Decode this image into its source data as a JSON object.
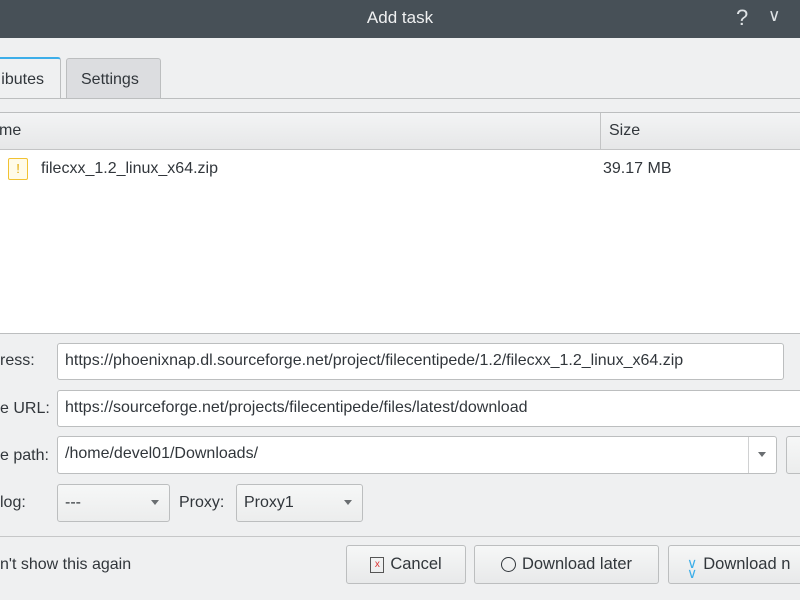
{
  "window": {
    "title": "Add task"
  },
  "tabs": [
    {
      "label": "ibutes",
      "active": true
    },
    {
      "label": "Settings",
      "active": false
    }
  ],
  "file_list": {
    "columns": [
      "me",
      "Size"
    ],
    "rows": [
      {
        "icon": "zip-file-icon",
        "name": "filecxx_1.2_linux_x64.zip",
        "size": "39.17 MB"
      }
    ]
  },
  "form": {
    "address_label": "ress:",
    "address_value": "https://phoenixnap.dl.sourceforge.net/project/filecentipede/1.2/filecxx_1.2_linux_x64.zip",
    "source_label": "e URL:",
    "source_value": "https://sourceforge.net/projects/filecentipede/files/latest/download",
    "path_label": "e path:",
    "path_value": "/home/devel01/Downloads/",
    "log_label": "log:",
    "log_value": "---",
    "proxy_label": "Proxy:",
    "proxy_value": "Proxy1"
  },
  "footer": {
    "dont_show": "n't show this again",
    "cancel": "Cancel",
    "later": "Download later",
    "now": "Download n"
  },
  "colors": {
    "accent": "#3daee9",
    "titlebar": "#475057"
  }
}
